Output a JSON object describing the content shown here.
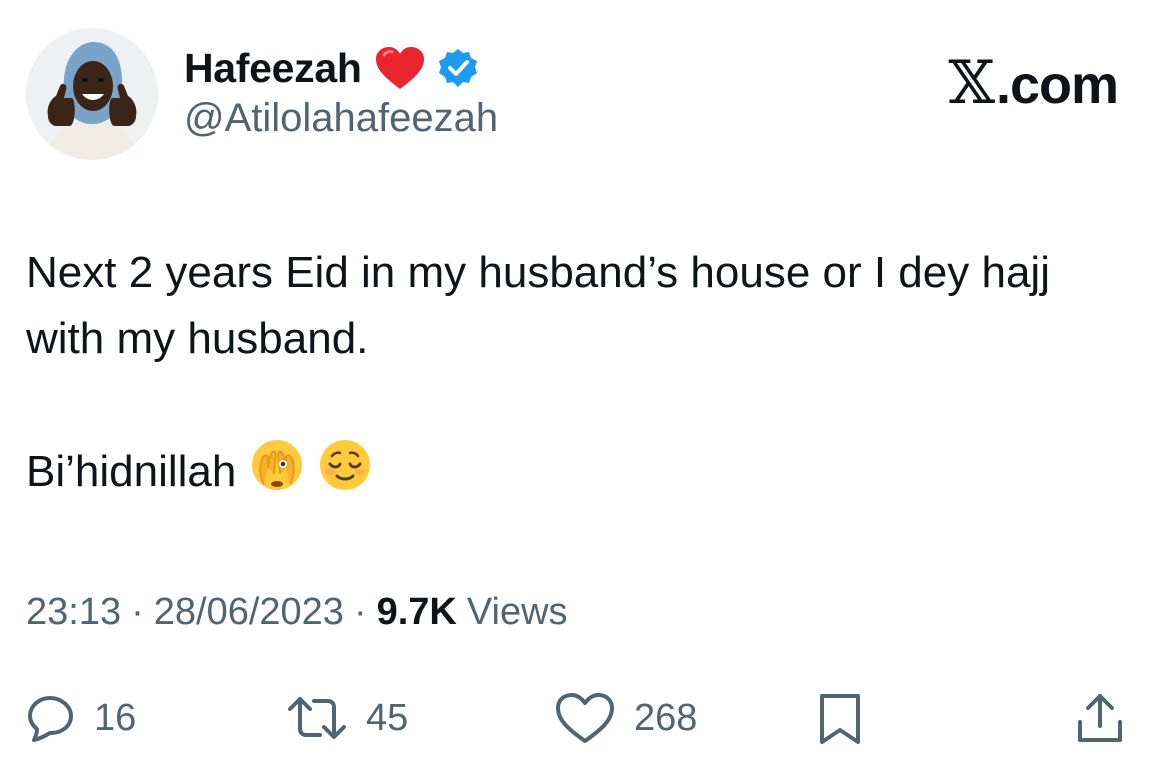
{
  "author": {
    "display_name": "Hafeezah",
    "handle": "@Atilolahafeezah",
    "avatar_icon": "memoji-thumbs-up-avatar",
    "heart_icon": "red-heart-icon",
    "verified_icon": "verified-badge-icon",
    "verified_color": "#1d9bf0"
  },
  "brand": {
    "label": ".com",
    "letter": "𝕏"
  },
  "tweet": {
    "line1": "Next 2 years Eid in my husband’s house or I dey hajj with my husband.",
    "line2": "Bi’hidnillah",
    "emoji_1": "face-with-peeking-eye-icon",
    "emoji_2": "relieved-face-icon"
  },
  "meta": {
    "time": "23:13",
    "sep1": "·",
    "date": "28/06/2023",
    "sep2": "·",
    "views_count": "9.7K",
    "views_label": "Views"
  },
  "actions": {
    "replies": "16",
    "reposts": "45",
    "likes": "268",
    "icon_color": "#536471"
  }
}
